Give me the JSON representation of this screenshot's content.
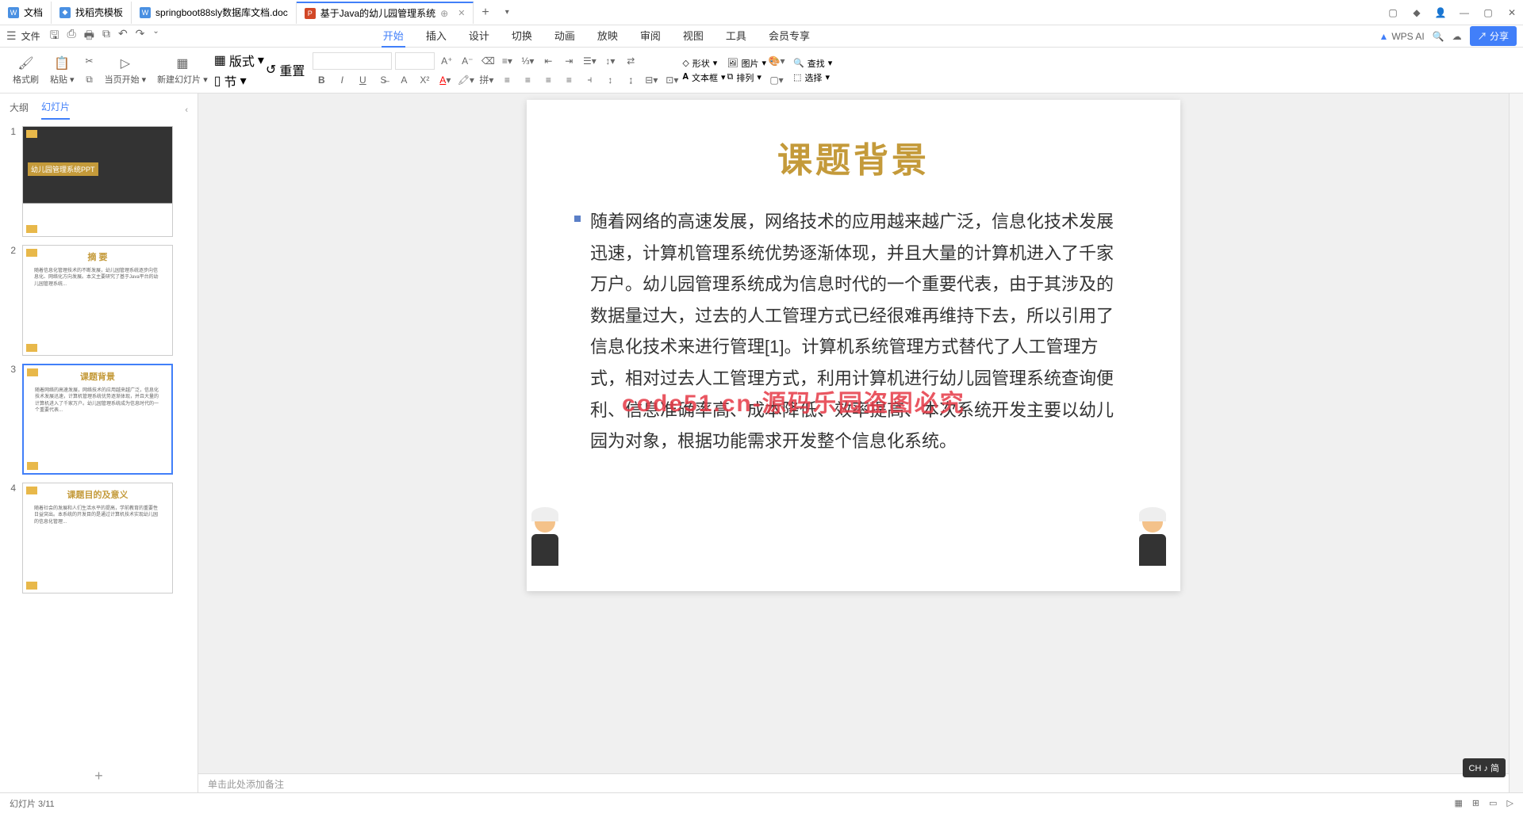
{
  "tabs": [
    {
      "icon": "doc",
      "label": "文档"
    },
    {
      "icon": "doc",
      "label": "找稻壳模板"
    },
    {
      "icon": "word",
      "label": "springboot88sly数据库文档.doc"
    },
    {
      "icon": "ppt",
      "label": "基于Java的幼儿园管理系统"
    }
  ],
  "file_menu": "文件",
  "menu": {
    "tabs": [
      "开始",
      "插入",
      "设计",
      "切换",
      "动画",
      "放映",
      "审阅",
      "视图",
      "工具",
      "会员专享"
    ],
    "wps_ai": "WPS AI",
    "share": "分享"
  },
  "ribbon": {
    "painter": "格式刷",
    "paste": "粘贴",
    "fromCurrent": "当页开始",
    "newSlide": "新建幻灯片",
    "layout": "版式",
    "section": "节",
    "reset": "重置",
    "shape": "形状",
    "picture": "图片",
    "textbox": "文本框",
    "arrange": "排列",
    "find": "查找",
    "select": "选择"
  },
  "panel": {
    "outline": "大纲",
    "slides": "幻灯片"
  },
  "thumbs": [
    {
      "num": "1",
      "title": "幼儿园管理系统PPT"
    },
    {
      "num": "2",
      "title": "摘  要"
    },
    {
      "num": "3",
      "title": "课题背景"
    },
    {
      "num": "4",
      "title": "课题目的及意义"
    }
  ],
  "slide": {
    "title": "课题背景",
    "body": "随着网络的高速发展，网络技术的应用越来越广泛，信息化技术发展迅速，计算机管理系统优势逐渐体现，并且大量的计算机进入了千家万户。幼儿园管理系统成为信息时代的一个重要代表，由于其涉及的数据量过大，过去的人工管理方式已经很难再维持下去，所以引用了信息化技术来进行管理[1]。计算机系统管理方式替代了人工管理方式，相对过去人工管理方式，利用计算机进行幼儿园管理系统查询便利、信息准确率高、成本降低、效率提高、本次系统开发主要以幼儿园为对象，根据功能需求开发整个信息化系统。",
    "watermark": "code51.cn-源码乐园盗图必究"
  },
  "notes_placeholder": "单击此处添加备注",
  "ime": "CH ♪ 简",
  "status": {
    "left": "幻灯片 3/11"
  }
}
